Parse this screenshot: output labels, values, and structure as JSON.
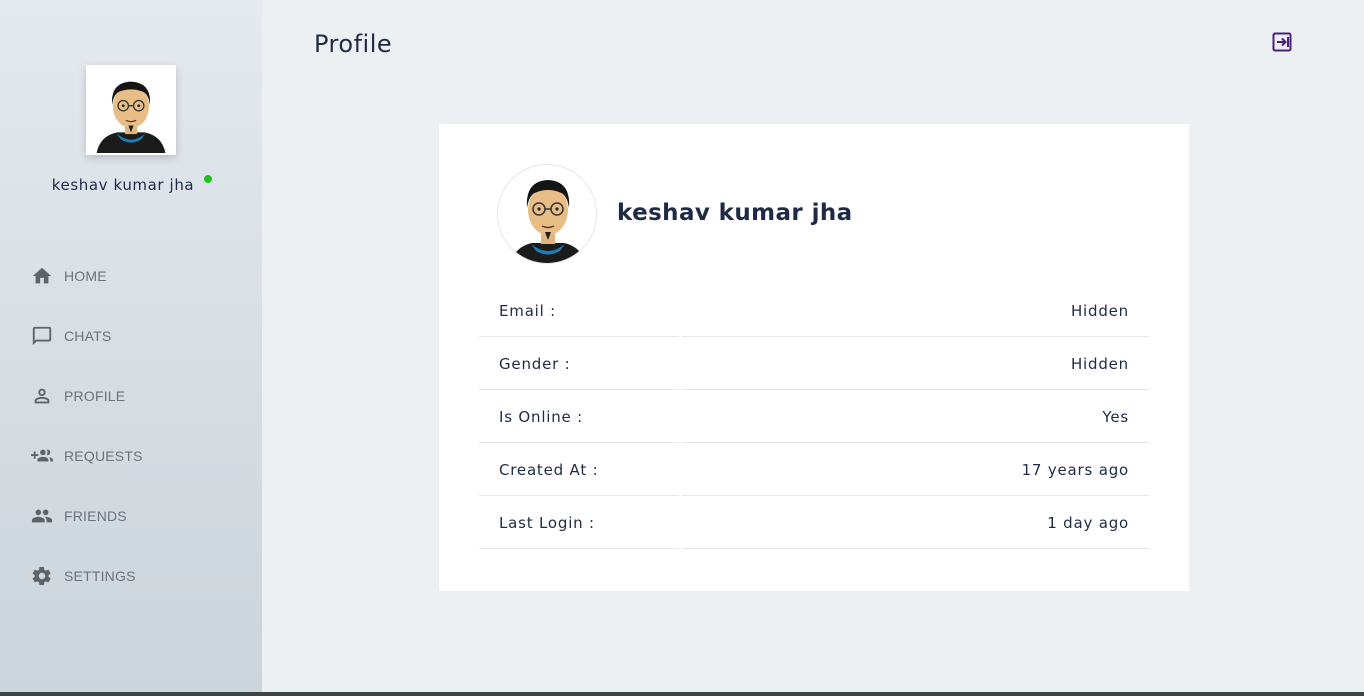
{
  "sidebar": {
    "user_name": "keshav kumar jha",
    "status_color": "#21c21e",
    "nav": [
      {
        "label": "HOME",
        "icon": "home-icon"
      },
      {
        "label": "CHATS",
        "icon": "chat-icon"
      },
      {
        "label": "PROFILE",
        "icon": "person-icon"
      },
      {
        "label": "REQUESTS",
        "icon": "add-group-icon"
      },
      {
        "label": "FRIENDS",
        "icon": "group-icon"
      },
      {
        "label": "SETTINGS",
        "icon": "gear-icon"
      }
    ]
  },
  "header": {
    "title": "Profile",
    "logout_icon": "logout-icon",
    "accent_color": "#4b1f7a"
  },
  "profile": {
    "name": "keshav kumar jha",
    "rows": [
      {
        "label": "Email :",
        "value": "Hidden"
      },
      {
        "label": "Gender :",
        "value": "Hidden"
      },
      {
        "label": "Is Online :",
        "value": "Yes"
      },
      {
        "label": "Created At :",
        "value": "17 years ago"
      },
      {
        "label": "Last Login :",
        "value": "1 day ago"
      }
    ]
  }
}
